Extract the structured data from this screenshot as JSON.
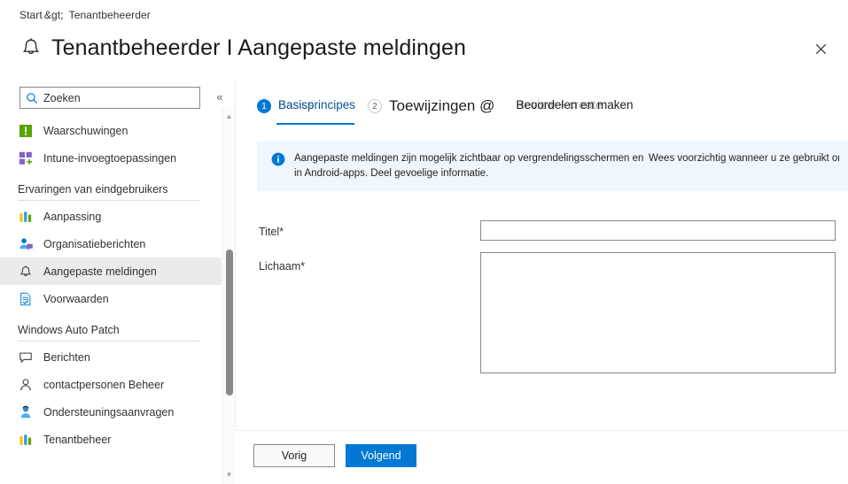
{
  "breadcrumb": {
    "root": "Start",
    "separator": "&gt;",
    "current": "Tenantbeheerder"
  },
  "header": {
    "icon": "bell-icon",
    "title": "Tenantbeheerder I Aangepaste meldingen",
    "close_label": "✕"
  },
  "sidebar": {
    "search": {
      "placeholder": "Zoeken",
      "value": "",
      "icon": "search-icon"
    },
    "collapse_label": "«",
    "items": [
      {
        "label": "Waarschuwingen",
        "icon": "alert-icon",
        "type": "item",
        "selected": false
      },
      {
        "label": "Intune-invoegtoepassingen",
        "icon": "addins-grid-icon",
        "type": "item",
        "selected": false
      },
      {
        "label": "Ervaringen van eindgebruikers",
        "type": "group"
      },
      {
        "label": "Aanpassing",
        "icon": "bars-chart-icon",
        "type": "item",
        "selected": false
      },
      {
        "label": "Organisatieberichten",
        "icon": "people-message-icon",
        "type": "item",
        "selected": false
      },
      {
        "label": "Aangepaste meldingen",
        "icon": "bell-icon",
        "type": "item",
        "selected": true
      },
      {
        "label": "Voorwaarden",
        "icon": "document-check-icon",
        "type": "item",
        "selected": false
      },
      {
        "label": "Windows Auto Patch",
        "type": "group"
      },
      {
        "label": "Berichten",
        "icon": "speech-bubble-icon",
        "type": "item",
        "selected": false
      },
      {
        "label": "contactpersonen Beheer",
        "icon": "person-icon",
        "type": "item",
        "selected": false
      },
      {
        "label": "Ondersteuningsaanvragen",
        "icon": "support-agent-icon",
        "type": "item",
        "selected": false
      },
      {
        "label": "Tenantbeheer",
        "icon": "bars-chart-icon",
        "type": "item",
        "selected": false
      }
    ],
    "scrollbar": {
      "up_arrow": "▲",
      "down_arrow": "▼"
    }
  },
  "tabs": [
    {
      "step": "1",
      "label": "Basisprincipes",
      "shadow_label": "Basics",
      "active": true,
      "step_filled": true
    },
    {
      "step": "2",
      "label": "Toewijzingen @",
      "shadow_label": "",
      "active": false,
      "step_filled": false
    },
    {
      "step": "",
      "label": "Beoordelen en maken",
      "shadow_label": "Review + create",
      "active": false,
      "step_filled": false
    }
  ],
  "banner": {
    "icon": "info-icon",
    "text_left": "Aangepaste meldingen zijn mogelijk zichtbaar op vergrendelingsschermen en in Android-apps. Deel gevoelige informatie.",
    "text_right": "Wees voorzichtig wanneer u ze gebruikt om"
  },
  "form": {
    "title_label": "Titel*",
    "title_value": "",
    "title_placeholder": "",
    "body_label": "Lichaam*",
    "body_value": "",
    "body_placeholder": ""
  },
  "footer": {
    "previous_label": "Vorig",
    "next_label": "Volgend"
  },
  "colors": {
    "accent": "#0078d4",
    "banner_bg": "#eff6fc",
    "selected_bg": "#edebe9",
    "border": "#8a8886"
  }
}
